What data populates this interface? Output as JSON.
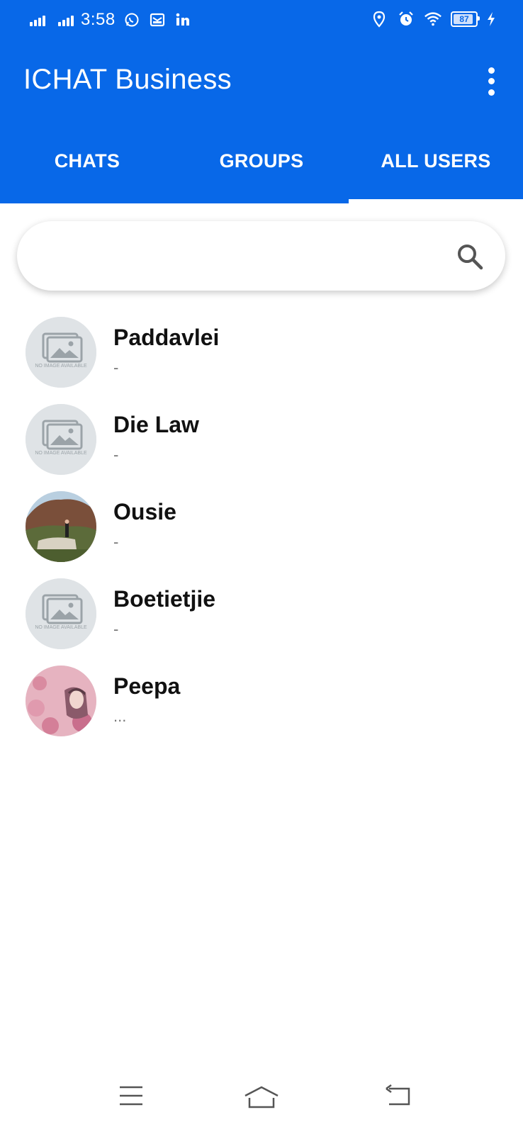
{
  "status_bar": {
    "time": "3:58",
    "battery": "87",
    "icons": [
      "signal-icon",
      "signal-icon",
      "whatsapp-icon",
      "mail-icon",
      "linkedin-icon",
      "location-icon",
      "alarm-icon",
      "wifi-icon",
      "battery-icon",
      "charging-icon"
    ]
  },
  "app_bar": {
    "title": "ICHAT Business",
    "menu_icon": "more-vert-icon"
  },
  "tabs": [
    {
      "label": "CHATS",
      "active": false
    },
    {
      "label": "GROUPS",
      "active": false
    },
    {
      "label": "ALL USERS",
      "active": true
    }
  ],
  "search": {
    "placeholder": "",
    "value": "",
    "icon": "search-icon"
  },
  "users": [
    {
      "name": "Paddavlei",
      "status": "-",
      "avatar": "no-image-placeholder",
      "avatar_text": "NO IMAGE AVAILABLE"
    },
    {
      "name": "Die Law",
      "status": "-",
      "avatar": "no-image-placeholder",
      "avatar_text": "NO IMAGE AVAILABLE"
    },
    {
      "name": "Ousie",
      "status": "-",
      "avatar": "landscape-photo"
    },
    {
      "name": "Boetietjie",
      "status": "-",
      "avatar": "no-image-placeholder",
      "avatar_text": "NO IMAGE AVAILABLE"
    },
    {
      "name": "Peepa",
      "status": "...",
      "avatar": "portrait-photo"
    }
  ],
  "nav_bar": {
    "icons": [
      "menu-icon",
      "home-icon",
      "back-icon"
    ]
  },
  "colors": {
    "primary": "#0868e8",
    "tab_indicator": "#ffffff",
    "placeholder_avatar": "#dfe3e6"
  }
}
